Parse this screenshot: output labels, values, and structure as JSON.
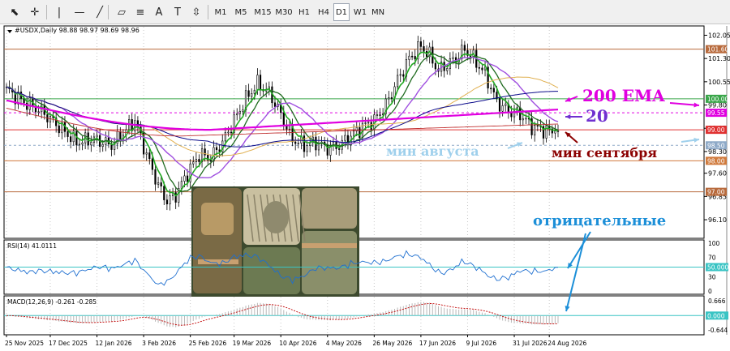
{
  "toolbar": {
    "tools": [
      {
        "icon": "cursor-icon"
      },
      {
        "icon": "crosshair-icon"
      },
      {
        "icon": "vertical-line-icon"
      },
      {
        "icon": "horizontal-line-icon"
      },
      {
        "icon": "trendline-icon"
      },
      {
        "icon": "equidistant-channel-icon"
      },
      {
        "icon": "fibonacci-icon"
      },
      {
        "icon": "text-icon"
      },
      {
        "icon": "text-label-icon"
      },
      {
        "icon": "arrows-shapes-icon"
      }
    ],
    "timeframes": [
      "M1",
      "M5",
      "M15",
      "M30",
      "H1",
      "H4",
      "D1",
      "W1",
      "MN"
    ],
    "active_timeframe": "D1"
  },
  "main_panel": {
    "header": "#USDX,Daily  98.88 98.97 98.69 98.96",
    "y_ticks": [
      "102.05",
      "101.30",
      "100.55",
      "99.80",
      "99.05",
      "98.30",
      "97.60",
      "96.85",
      "96.10"
    ],
    "price_labels": [
      {
        "text": "101.60",
        "value": 101.6,
        "color": "#b86a3c"
      },
      {
        "text": "100.00",
        "value": 100.0,
        "color": "#3aa64a"
      },
      {
        "text": "99.55",
        "value": 99.55,
        "color": "#e000e0"
      },
      {
        "text": "99.00",
        "value": 99.0,
        "color": "#e03030"
      },
      {
        "text": "98.50",
        "value": 98.5,
        "color": "#8faac8"
      },
      {
        "text": "98.00",
        "value": 98.0,
        "color": "#d07a3c"
      },
      {
        "text": "97.00",
        "value": 97.0,
        "color": "#b86a3c"
      }
    ],
    "ylim": [
      95.5,
      102.35
    ]
  },
  "annotations": {
    "ema200": "200 EMA",
    "twenty": "20",
    "august_min": "мин августа",
    "september_min": "мин сентября",
    "negative": "отрицательные"
  },
  "rsi_panel": {
    "header": "RSI(14) 41.0111",
    "ticks": [
      "100",
      "70",
      "30",
      "0"
    ],
    "level_label": "50.000"
  },
  "macd_panel": {
    "header": "MACD(12,26,9) -0.261 -0.285",
    "ticks": [
      "0.666",
      "-0.644"
    ],
    "level_label": "0.000"
  },
  "x_labels": [
    "25 Nov 2025",
    "17 Dec 2025",
    "12 Jan 2026",
    "3 Feb 2026",
    "25 Feb 2026",
    "19 Mar 2026",
    "10 Apr 2026",
    "4 May 2026",
    "26 May 2026",
    "17 Jun 2026",
    "9 Jul 2026",
    "31 Jul 2026",
    "24 Aug 2026"
  ],
  "chart_data": {
    "type": "line",
    "title": "#USDX,Daily",
    "categories": [
      "25 Nov 2025",
      "17 Dec 2025",
      "12 Jan 2026",
      "3 Feb 2026",
      "25 Feb 2026",
      "19 Mar 2026",
      "10 Apr 2026",
      "4 May 2026",
      "26 May 2026",
      "17 Jun 2026",
      "9 Jul 2026",
      "31 Jul 2026",
      "24 Aug 2026"
    ],
    "series": [
      {
        "name": "",
        "values": [
          100.3,
          99.1,
          99.0,
          97.3,
          98.3,
          100.4,
          98.6,
          98.4,
          99.2,
          101.7,
          101.3,
          99.6,
          98.96
        ]
      },
      {
        "name": "200 EMA",
        "values": [
          99.95,
          99.72,
          99.45,
          99.2,
          99.05,
          99.0,
          99.05,
          99.1,
          99.2,
          99.35,
          99.5,
          99.55,
          99.58
        ]
      }
    ],
    "ylim": [
      95.5,
      102.35
    ]
  }
}
